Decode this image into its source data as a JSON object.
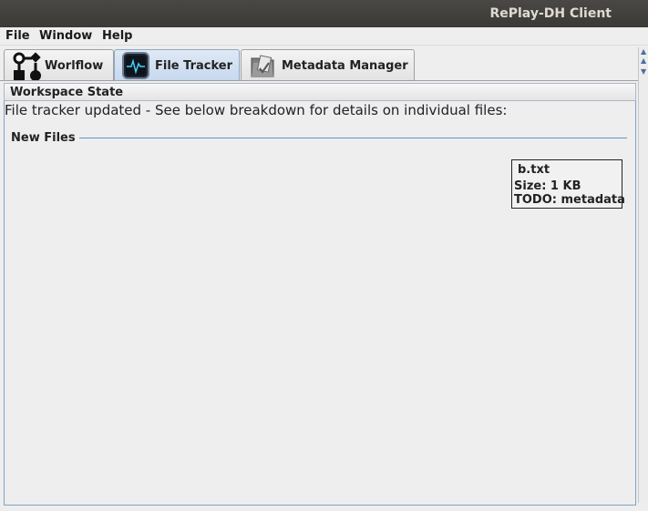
{
  "window": {
    "title": "RePlay-DH Client"
  },
  "menu": [
    "File",
    "Window",
    "Help"
  ],
  "tabs": [
    {
      "label": "Worlflow",
      "icon": "workflow-icon",
      "selected": false
    },
    {
      "label": "File Tracker",
      "icon": "file-tracker-icon",
      "selected": true
    },
    {
      "label": "Metadata Manager",
      "icon": "metadata-manager-icon",
      "selected": false
    }
  ],
  "panel": {
    "header": "Workspace State",
    "status": "File tracker updated - See below breakdown for details on individual files:",
    "section_title": "New Files",
    "files": [
      {
        "name": "b.txt",
        "size": "Size: 1 KB",
        "todo": "TODO: metadata"
      }
    ]
  },
  "colors": {
    "titlebar": "#3b3a36",
    "selected_tab": "#c6d8ee",
    "panel_border": "#7ea3c9",
    "section_line": "#6a8fcf"
  }
}
